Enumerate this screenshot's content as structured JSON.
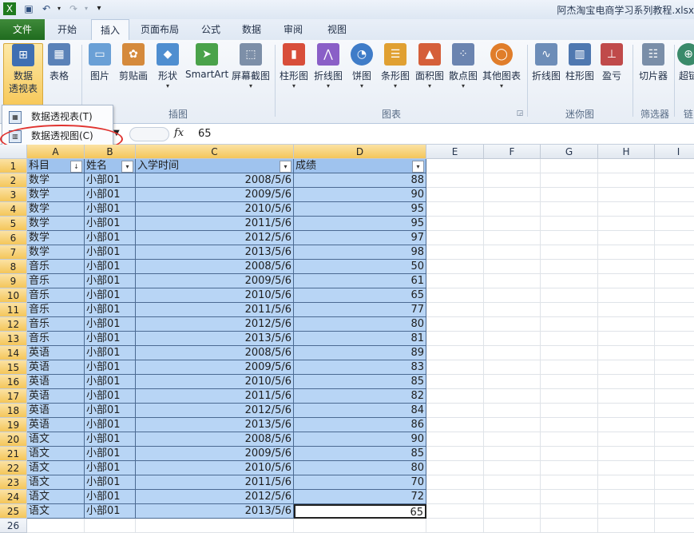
{
  "title": "阿杰淘宝电商学习系列教程.xlsx",
  "tabs": [
    {
      "label": "文件",
      "kind": "file"
    },
    {
      "label": "开始",
      "kind": ""
    },
    {
      "label": "插入",
      "kind": "active"
    },
    {
      "label": "页面布局",
      "kind": ""
    },
    {
      "label": "公式",
      "kind": ""
    },
    {
      "label": "数据",
      "kind": ""
    },
    {
      "label": "审阅",
      "kind": ""
    },
    {
      "label": "视图",
      "kind": ""
    }
  ],
  "ribbon": {
    "pivot": "数据\n透视表",
    "table": "表格",
    "picture": "图片",
    "clipart": "剪贴画",
    "shapes": "形状",
    "smartart": "SmartArt",
    "screenshot": "屏幕截图",
    "column": "柱形图",
    "line": "折线图",
    "pie": "饼图",
    "bar": "条形图",
    "area": "面积图",
    "scatter": "散点图",
    "other": "其他图表",
    "sp_line": "折线图",
    "sp_col": "柱形图",
    "sp_winloss": "盈亏",
    "slicer": "切片器",
    "hyperlink": "超链",
    "group_illus": "插图",
    "group_chart": "图表",
    "group_spark": "迷你图",
    "group_filter": "筛选器",
    "group_link": "链"
  },
  "dropdown": {
    "item1": "数据透视表(T)",
    "item2": "数据透视图(C)"
  },
  "formula_bar": {
    "fx": "fx",
    "value": "65"
  },
  "columns": [
    "A",
    "B",
    "C",
    "D",
    "E",
    "F",
    "G",
    "H",
    "I"
  ],
  "headers": [
    "科目",
    "姓名",
    "入学时间",
    "成绩"
  ],
  "rows": [
    [
      "数学",
      "小部01",
      "2008/5/6",
      "88"
    ],
    [
      "数学",
      "小部01",
      "2009/5/6",
      "90"
    ],
    [
      "数学",
      "小部01",
      "2010/5/6",
      "95"
    ],
    [
      "数学",
      "小部01",
      "2011/5/6",
      "95"
    ],
    [
      "数学",
      "小部01",
      "2012/5/6",
      "97"
    ],
    [
      "数学",
      "小部01",
      "2013/5/6",
      "98"
    ],
    [
      "音乐",
      "小部01",
      "2008/5/6",
      "50"
    ],
    [
      "音乐",
      "小部01",
      "2009/5/6",
      "61"
    ],
    [
      "音乐",
      "小部01",
      "2010/5/6",
      "65"
    ],
    [
      "音乐",
      "小部01",
      "2011/5/6",
      "77"
    ],
    [
      "音乐",
      "小部01",
      "2012/5/6",
      "80"
    ],
    [
      "音乐",
      "小部01",
      "2013/5/6",
      "81"
    ],
    [
      "英语",
      "小部01",
      "2008/5/6",
      "89"
    ],
    [
      "英语",
      "小部01",
      "2009/5/6",
      "83"
    ],
    [
      "英语",
      "小部01",
      "2010/5/6",
      "85"
    ],
    [
      "英语",
      "小部01",
      "2011/5/6",
      "82"
    ],
    [
      "英语",
      "小部01",
      "2012/5/6",
      "84"
    ],
    [
      "英语",
      "小部01",
      "2013/5/6",
      "86"
    ],
    [
      "语文",
      "小部01",
      "2008/5/6",
      "90"
    ],
    [
      "语文",
      "小部01",
      "2009/5/6",
      "85"
    ],
    [
      "语文",
      "小部01",
      "2010/5/6",
      "80"
    ],
    [
      "语文",
      "小部01",
      "2011/5/6",
      "70"
    ],
    [
      "语文",
      "小部01",
      "2012/5/6",
      "72"
    ],
    [
      "语文",
      "小部01",
      "2013/5/6",
      "65"
    ]
  ],
  "row_numbers": [
    "1",
    "2",
    "3",
    "4",
    "5",
    "6",
    "7",
    "8",
    "9",
    "10",
    "11",
    "12",
    "13",
    "14",
    "15",
    "16",
    "17",
    "18",
    "19",
    "20",
    "21",
    "22",
    "23",
    "24",
    "25",
    "26"
  ]
}
